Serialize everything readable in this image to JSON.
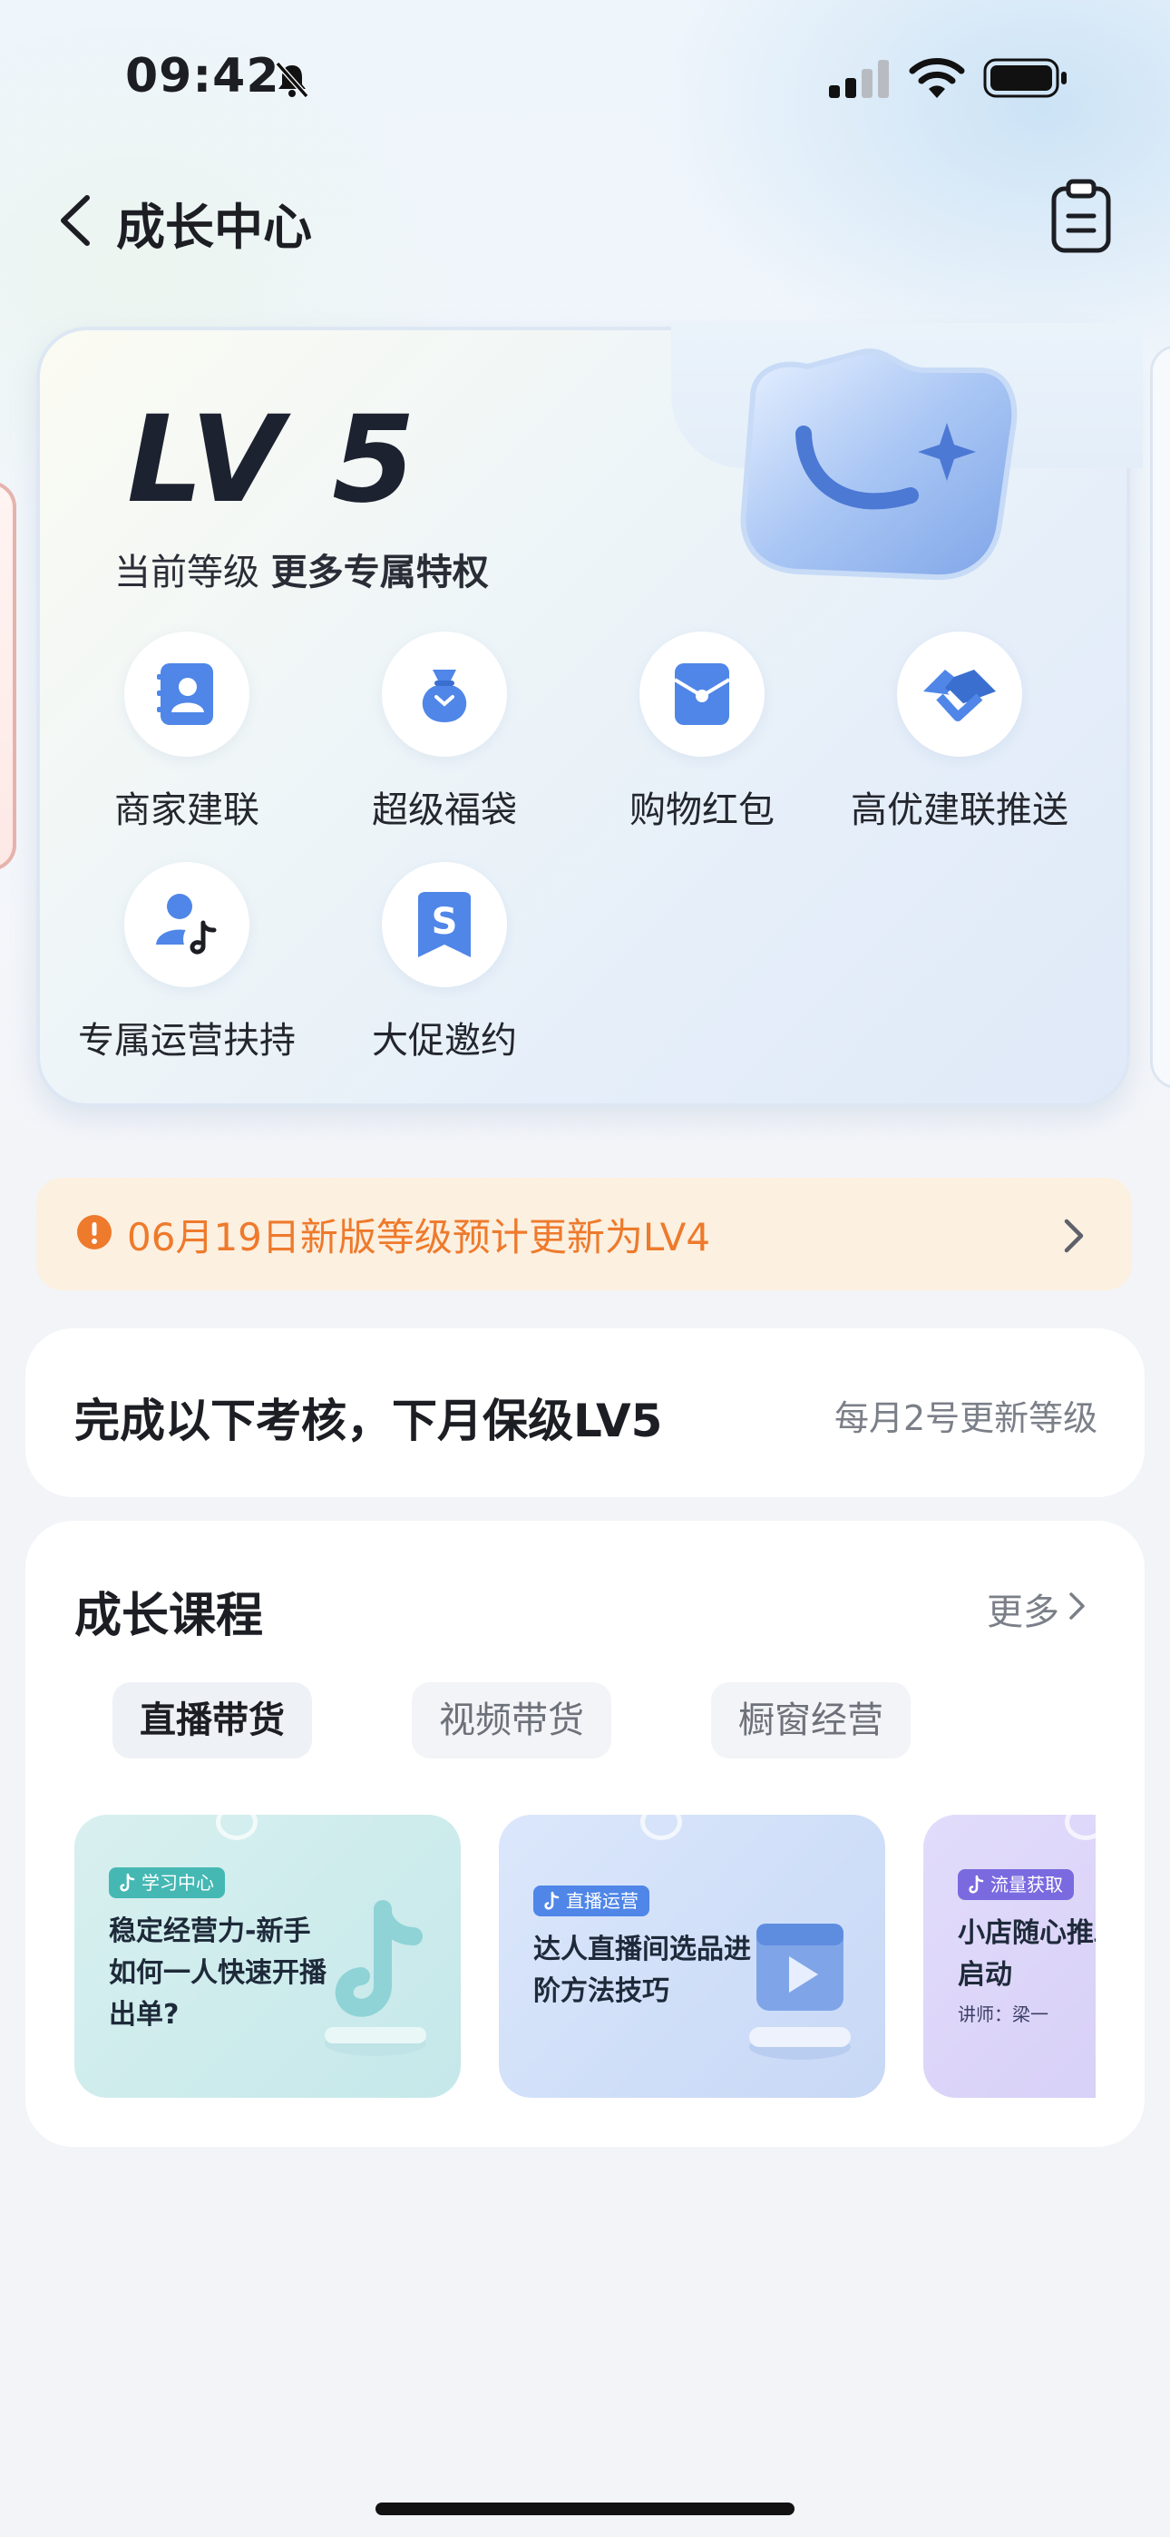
{
  "status_bar": {
    "time": "09:42"
  },
  "header": {
    "title": "成长中心"
  },
  "level_card": {
    "level": "LV 5",
    "subtitle_prefix": "当前等级",
    "subtitle_bold": "更多专属特权",
    "privileges": [
      {
        "label": "商家建联",
        "icon": "contact-book-icon"
      },
      {
        "label": "超级福袋",
        "icon": "lucky-bag-icon"
      },
      {
        "label": "购物红包",
        "icon": "red-envelope-icon"
      },
      {
        "label": "高优建联推送",
        "icon": "handshake-icon"
      },
      {
        "label": "专属运营扶持",
        "icon": "operator-support-icon"
      },
      {
        "label": "大促邀约",
        "icon": "promo-invite-icon"
      }
    ]
  },
  "notice": {
    "text": "06月19日新版等级预计更新为LV4",
    "color": "#ee7a2c"
  },
  "assessment": {
    "title": "完成以下考核，下月保级LV5",
    "note": "每月2号更新等级"
  },
  "courses": {
    "title": "成长课程",
    "more": "更多",
    "tabs": [
      "直播带货",
      "视频带货",
      "橱窗经营"
    ],
    "items": [
      {
        "tag": "学习中心",
        "text": "稳定经营力-新手如何一人快速开播出单?",
        "lecturer": ""
      },
      {
        "tag": "直播运营",
        "text": "达人直播间选品进阶方法技巧",
        "lecturer": ""
      },
      {
        "tag": "流量获取",
        "text": "小店随心推助直播间冷启动",
        "lecturer": "讲师：梁一"
      }
    ]
  },
  "colors": {
    "accent_blue": "#4f86e8",
    "notice_bg": "#fcf0e0"
  }
}
